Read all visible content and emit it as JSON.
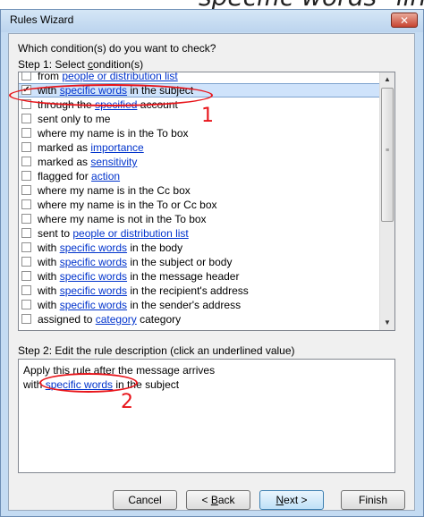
{
  "banner_text": "specific words\" link.",
  "window": {
    "title": "Rules Wizard",
    "close_label": "✕"
  },
  "question": "Which condition(s) do you want to check?",
  "step1": {
    "before": "Step 1: Select ",
    "underlined": "c",
    "after": "ondition(s)"
  },
  "conditions": [
    {
      "checked": false,
      "pre": "from ",
      "link": "people or distribution list",
      "post": ""
    },
    {
      "checked": true,
      "pre": "with ",
      "link": "specific words",
      "post": " in the subject"
    },
    {
      "checked": false,
      "pre": "through the ",
      "link": "specified",
      "post": " account"
    },
    {
      "checked": false,
      "pre": "sent only to me",
      "link": "",
      "post": ""
    },
    {
      "checked": false,
      "pre": "where my name is in the To box",
      "link": "",
      "post": ""
    },
    {
      "checked": false,
      "pre": "marked as ",
      "link": "importance",
      "post": ""
    },
    {
      "checked": false,
      "pre": "marked as ",
      "link": "sensitivity",
      "post": ""
    },
    {
      "checked": false,
      "pre": "flagged for ",
      "link": "action",
      "post": ""
    },
    {
      "checked": false,
      "pre": "where my name is in the Cc box",
      "link": "",
      "post": ""
    },
    {
      "checked": false,
      "pre": "where my name is in the To or Cc box",
      "link": "",
      "post": ""
    },
    {
      "checked": false,
      "pre": "where my name is not in the To box",
      "link": "",
      "post": ""
    },
    {
      "checked": false,
      "pre": "sent to ",
      "link": "people or distribution list",
      "post": ""
    },
    {
      "checked": false,
      "pre": "with ",
      "link": "specific words",
      "post": " in the body"
    },
    {
      "checked": false,
      "pre": "with ",
      "link": "specific words",
      "post": " in the subject or body"
    },
    {
      "checked": false,
      "pre": "with ",
      "link": "specific words",
      "post": " in the message header"
    },
    {
      "checked": false,
      "pre": "with ",
      "link": "specific words",
      "post": " in the recipient's address"
    },
    {
      "checked": false,
      "pre": "with ",
      "link": "specific words",
      "post": " in the sender's address"
    },
    {
      "checked": false,
      "pre": "assigned to ",
      "link": "category",
      "post": " category"
    }
  ],
  "step2_label": "Step 2: Edit the rule description (click an underlined value)",
  "description": {
    "line1": "Apply this rule after the message arrives",
    "line2_pre": "with ",
    "line2_link": "specific words",
    "line2_post": " in the subject"
  },
  "buttons": {
    "cancel": "Cancel",
    "back_pre": "< ",
    "back_u": "B",
    "back_post": "ack",
    "next_u": "N",
    "next_post": "ext >",
    "finish": "Finish"
  },
  "annotations": {
    "one": "1",
    "two": "2",
    "color": "#e8141a"
  }
}
